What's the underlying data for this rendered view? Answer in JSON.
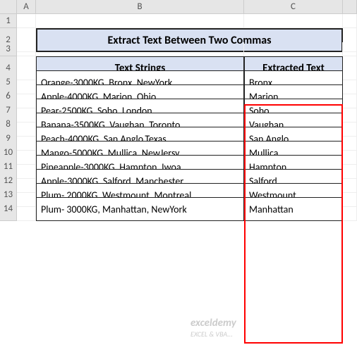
{
  "columns": [
    "",
    "A",
    "B",
    "C",
    ""
  ],
  "row_numbers": [
    "1",
    "2",
    "3",
    "4",
    "5",
    "6",
    "7",
    "8",
    "9",
    "10",
    "11",
    "12",
    "13",
    "14"
  ],
  "title": "Extract Text Between Two Commas",
  "headers": {
    "col_b": "Text Strings",
    "col_c": "Extracted Text"
  },
  "rows": [
    {
      "b": "Orange-3000KG, Bronx, NewYork",
      "c": "Bronx"
    },
    {
      "b": "Apple-4000KG, Marion, Ohio",
      "c": "Marion"
    },
    {
      "b": "Pear-2500KG, Soho, London",
      "c": "Soho"
    },
    {
      "b": "Banana-3500KG, Vaughan, Toronto",
      "c": "Vaughan"
    },
    {
      "b": "Peach-4000KG, San Anglo,Texas",
      "c": "San Anglo"
    },
    {
      "b": "Mango-5000KG, Mullica, NewJersy",
      "c": "Mullica"
    },
    {
      "b": "Pineapple-3000KG, Hampton, Iwoa",
      "c": "Hampton"
    },
    {
      "b": "Apple-3000KG, Salford, Manchester",
      "c": "Salford"
    },
    {
      "b": "Plum- 2000KG, Westmount, Montreal",
      "c": "Westmount"
    },
    {
      "b": "Plum- 3000KG, Manhattan, NewYork",
      "c": "Manhattan"
    }
  ],
  "watermark": {
    "line1": "exceldemy",
    "line2": "EXCEL & VBA..."
  },
  "chart_data": {
    "type": "table",
    "title": "Extract Text Between Two Commas",
    "columns": [
      "Text Strings",
      "Extracted Text"
    ],
    "data": [
      [
        "Orange-3000KG, Bronx, NewYork",
        "Bronx"
      ],
      [
        "Apple-4000KG, Marion, Ohio",
        "Marion"
      ],
      [
        "Pear-2500KG, Soho, London",
        "Soho"
      ],
      [
        "Banana-3500KG, Vaughan, Toronto",
        "Vaughan"
      ],
      [
        "Peach-4000KG, San Anglo,Texas",
        "San Anglo"
      ],
      [
        "Mango-5000KG, Mullica, NewJersy",
        "Mullica"
      ],
      [
        "Pineapple-3000KG, Hampton, Iwoa",
        "Hampton"
      ],
      [
        "Apple-3000KG, Salford, Manchester",
        "Salford"
      ],
      [
        "Plum- 2000KG, Westmount, Montreal",
        "Westmount"
      ],
      [
        "Plum- 3000KG, Manhattan, NewYork",
        "Manhattan"
      ]
    ]
  }
}
